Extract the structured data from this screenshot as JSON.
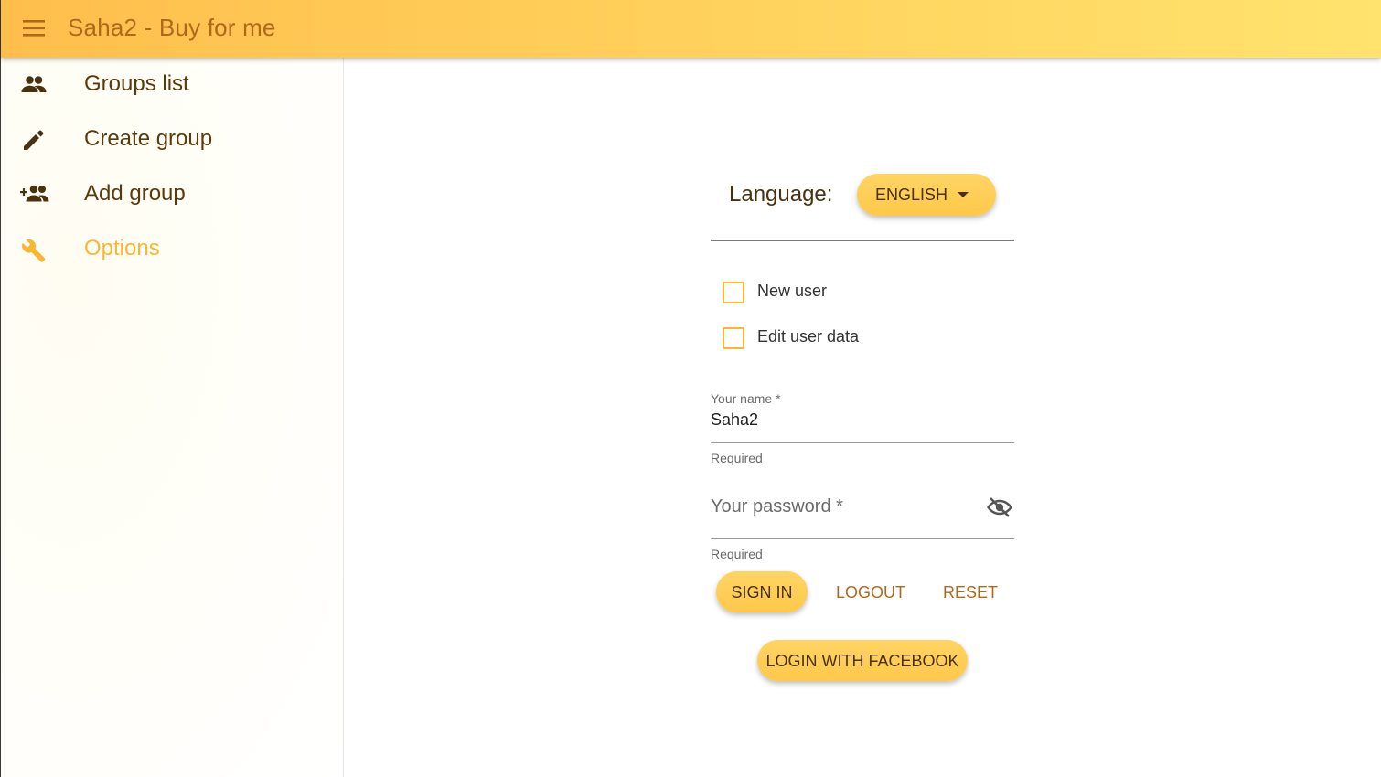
{
  "appbar": {
    "title": "Saha2 - Buy for me",
    "menu_icon": "menu-icon"
  },
  "drawer": {
    "items": [
      {
        "label": "Groups list",
        "icon": "group-icon",
        "active": false
      },
      {
        "label": "Create group",
        "icon": "pencil-icon",
        "active": false
      },
      {
        "label": "Add group",
        "icon": "group-add-icon",
        "active": false
      },
      {
        "label": "Options",
        "icon": "wrench-icon",
        "active": true
      }
    ]
  },
  "form": {
    "language_label": "Language:",
    "language_value": "ENGLISH",
    "checkboxes": [
      {
        "label": "New user",
        "checked": false
      },
      {
        "label": "Edit user data",
        "checked": false
      }
    ],
    "name_field": {
      "label": "Your name *",
      "value": "Saha2",
      "helper": "Required"
    },
    "password_field": {
      "placeholder": "Your password *",
      "helper": "Required",
      "visibility_icon": "eye-off-icon"
    },
    "buttons": {
      "sign_in": "SIGN IN",
      "logout": "LOGOUT",
      "reset": "RESET",
      "facebook": "LOGIN WITH FACEBOOK"
    }
  },
  "colors": {
    "accent": "#f7b733",
    "appbar_start": "#ffbe4c",
    "appbar_end": "#ffe36e",
    "title_text": "#b0691a",
    "nav_text": "#5a3a0e"
  }
}
